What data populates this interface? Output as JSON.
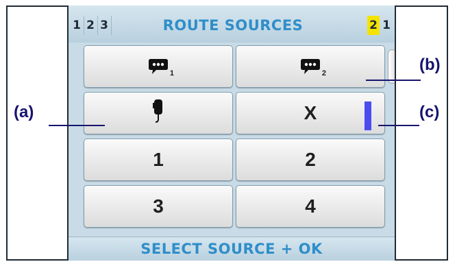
{
  "header": {
    "left_digits": [
      "1",
      "2",
      "3"
    ],
    "title": "ROUTE SOURCES",
    "right_digits": [
      "2",
      "1"
    ]
  },
  "buttons": [
    {
      "id": "src-1",
      "type": "speech-icon",
      "subscript": "1"
    },
    {
      "id": "src-2",
      "type": "speech-icon",
      "subscript": "2"
    },
    {
      "id": "src-mic",
      "type": "mic-icon"
    },
    {
      "id": "src-x",
      "label": "X"
    },
    {
      "id": "src-num-1",
      "label": "1"
    },
    {
      "id": "src-num-2",
      "label": "2"
    },
    {
      "id": "src-num-3",
      "label": "3"
    },
    {
      "id": "src-num-4",
      "label": "4"
    }
  ],
  "footer": {
    "text": "SELECT SOURCE + OK"
  },
  "callouts": {
    "a": "(a)",
    "b": "(b)",
    "c": "(c)"
  },
  "colors": {
    "title": "#2f8ec9",
    "highlight": "#f3e400",
    "marker": "#4a4cf0",
    "callout": "#16146e"
  }
}
